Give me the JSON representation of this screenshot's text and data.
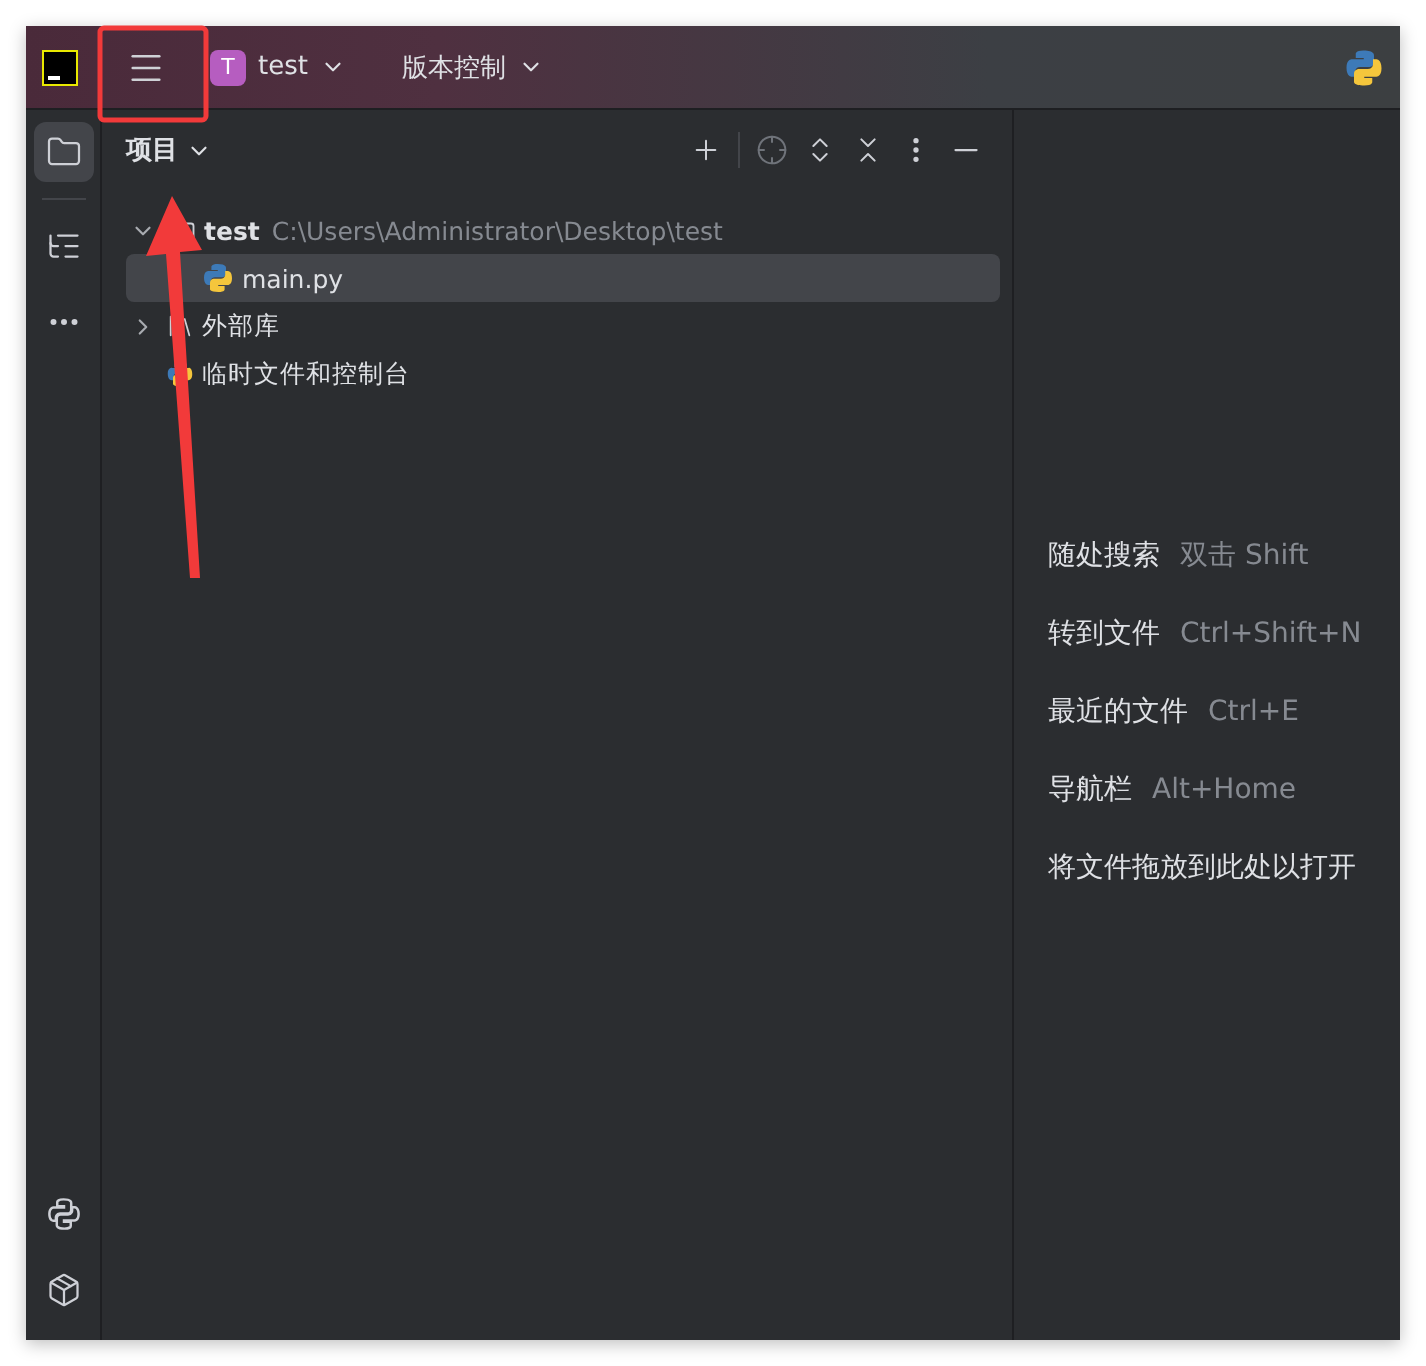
{
  "title_bar": {
    "project": {
      "initial": "T",
      "name": "test"
    },
    "vcs": "版本控制"
  },
  "tool_strip": {
    "top": [
      {
        "kind": "project",
        "selected": true
      },
      {
        "kind": "structure",
        "selected": false
      },
      {
        "kind": "more",
        "selected": false
      }
    ],
    "bottom": [
      {
        "kind": "python"
      },
      {
        "kind": "packages"
      }
    ]
  },
  "project_panel": {
    "title": "项目",
    "tree": [
      {
        "name": "test",
        "path": "C:\\Users\\Administrator\\Desktop\\test",
        "kind": "folder",
        "expanded": true,
        "selected": false,
        "children": [
          {
            "name": "main.py",
            "kind": "python",
            "selected": true
          }
        ]
      },
      {
        "name": "外部库",
        "kind": "library",
        "expanded": false,
        "selected": false
      },
      {
        "name": "临时文件和控制台",
        "kind": "scratch",
        "selected": false
      }
    ]
  },
  "editor_hints": [
    {
      "label": "随处搜索",
      "shortcut": "双击 Shift"
    },
    {
      "label": "转到文件",
      "shortcut": "Ctrl+Shift+N"
    },
    {
      "label": "最近的文件",
      "shortcut": "Ctrl+E"
    },
    {
      "label": "导航栏",
      "shortcut": "Alt+Home"
    },
    {
      "label": "将文件拖放到此处以打开"
    }
  ]
}
